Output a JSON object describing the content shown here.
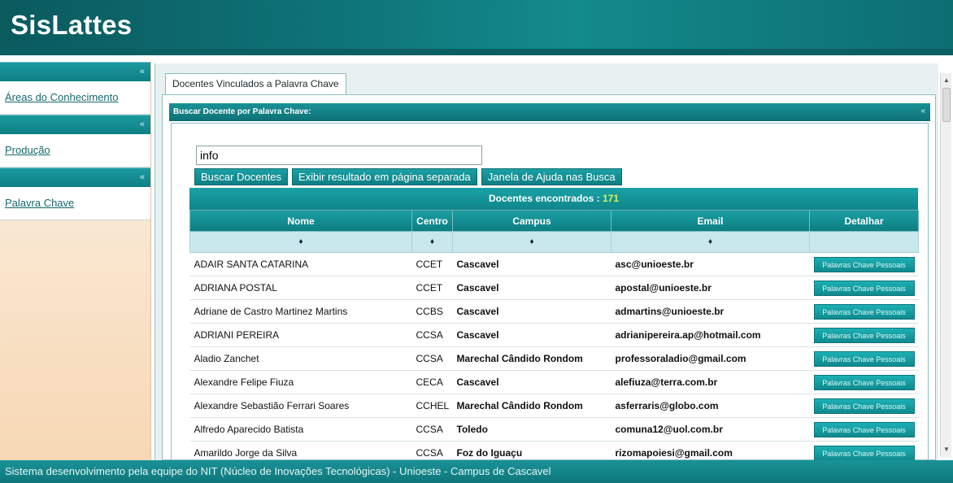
{
  "app": {
    "title": "SisLattes"
  },
  "sidebar": {
    "collapse_glyph": "«",
    "items": [
      {
        "label": "Áreas do Conhecimento"
      },
      {
        "label": "Produção"
      },
      {
        "label": "Palavra Chave"
      }
    ]
  },
  "main": {
    "tab_label": "Docentes Vinculados a Palavra Chave",
    "panel_title": "Buscar Docente por Palavra Chave:",
    "panel_collapse_glyph": "«",
    "search": {
      "value": "info"
    },
    "buttons": {
      "search": "Buscar Docentes",
      "separate_page": "Exibir resultado em página separada",
      "help": "Janela de Ajuda nas Busca"
    },
    "results": {
      "caption_label": "Docentes encontrados : ",
      "count": "171",
      "columns": [
        "Nome",
        "Centro",
        "Campus",
        "Email",
        "Detalhar"
      ],
      "sort_glyph": "♦",
      "detail_label": "Palavras Chave Pessoais",
      "rows": [
        {
          "nome": "ADAIR SANTA CATARINA",
          "centro": "CCET",
          "campus": "Cascavel",
          "email": "asc@unioeste.br"
        },
        {
          "nome": "ADRIANA POSTAL",
          "centro": "CCET",
          "campus": "Cascavel",
          "email": "apostal@unioeste.br"
        },
        {
          "nome": "Adriane de Castro Martinez Martins",
          "centro": "CCBS",
          "campus": "Cascavel",
          "email": "admartins@unioeste.br"
        },
        {
          "nome": "ADRIANI PEREIRA",
          "centro": "CCSA",
          "campus": "Cascavel",
          "email": "adrianipereira.ap@hotmail.com"
        },
        {
          "nome": "Aladio Zanchet",
          "centro": "CCSA",
          "campus": "Marechal Cândido Rondom",
          "email": "professoraladio@gmail.com"
        },
        {
          "nome": "Alexandre Felipe Fiuza",
          "centro": "CECA",
          "campus": "Cascavel",
          "email": "alefiuza@terra.com.br"
        },
        {
          "nome": "Alexandre Sebastião Ferrari Soares",
          "centro": "CCHEL",
          "campus": "Marechal Cândido Rondom",
          "email": "asferraris@globo.com"
        },
        {
          "nome": "Alfredo Aparecido Batista",
          "centro": "CCSA",
          "campus": "Toledo",
          "email": "comuna12@uol.com.br"
        },
        {
          "nome": "Amarildo Jorge da Silva",
          "centro": "CCSA",
          "campus": "Foz do Iguaçu",
          "email": "rizomapoiesi@gmail.com"
        }
      ]
    }
  },
  "scrollbar": {
    "up_glyph": "▲",
    "down_glyph": "▼"
  },
  "footer": {
    "text": "Sistema desenvolvimento pela equipe do NIT (Núcleo de Inovações Tecnológicas) - Unioeste - Campus de Cascavel"
  },
  "colors": {
    "brand": "#0e7378",
    "accent_count": "#d7f05a",
    "sidebar_bg": "#f7d8b4"
  }
}
